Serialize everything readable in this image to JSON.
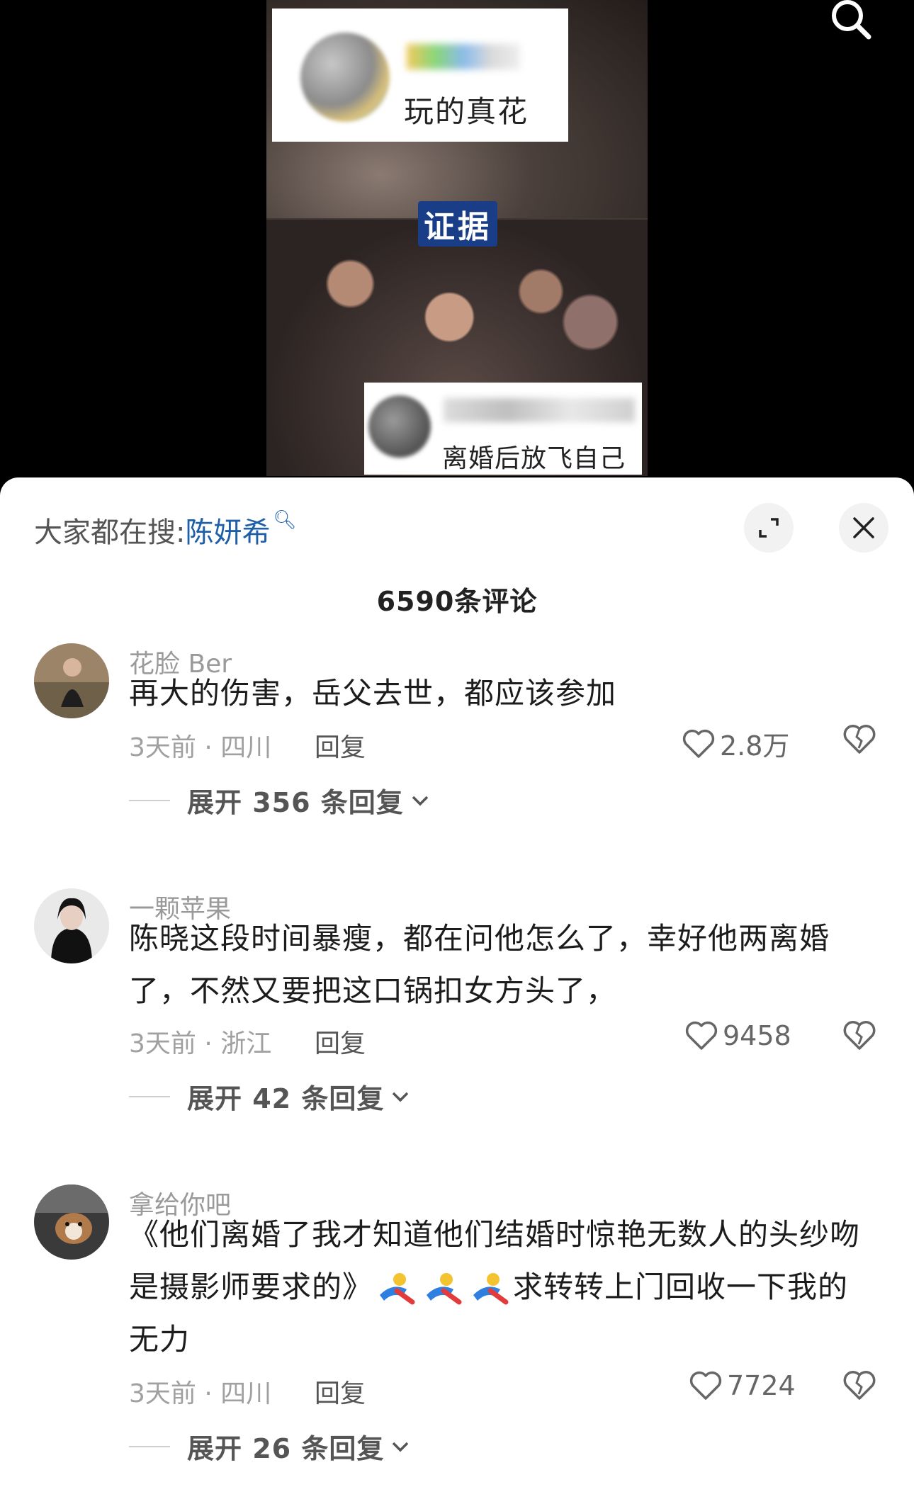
{
  "video": {
    "caption_top": "玩的真花",
    "evidence_label": "证据",
    "caption_bottom": "离婚后放飞自己了",
    "search_icon": "search-icon"
  },
  "panel": {
    "trending_prefix": "大家都在搜:",
    "trending_keyword": "陈妍希",
    "expand_icon": "expand-icon",
    "close_icon": "close-icon",
    "comment_count": "6590条评论"
  },
  "comments": [
    {
      "author": "花脸 Ber",
      "text": "再大的伤害，岳父去世，都应该参加",
      "meta": "3天前 · 四川",
      "reply": "回复",
      "likes": "2.8万",
      "expand": "展开 356 条回复"
    },
    {
      "author": "一颗苹果",
      "text_line1": "陈晓这段时间暴瘦，都在问他怎么了，幸好他两离婚",
      "text_line2": "了，不然又要把这口锅扣女方头了，",
      "meta": "3天前 · 浙江",
      "reply": "回复",
      "likes": "9458",
      "expand": "展开 42 条回复"
    },
    {
      "author": "拿给你吧",
      "text_line1": "《他们离婚了我才知道他们结婚时惊艳无数人的头纱吻",
      "text_line2a": "是摄影师要求的》",
      "text_line2b": "求转转上门回收一下我的",
      "text_line3": "无力",
      "meta": "3天前 · 四川",
      "reply": "回复",
      "likes": "7724",
      "expand": "展开 26 条回复"
    }
  ],
  "colors": {
    "link_blue": "#1f5fa8",
    "meta_gray": "#a0a0a0"
  }
}
